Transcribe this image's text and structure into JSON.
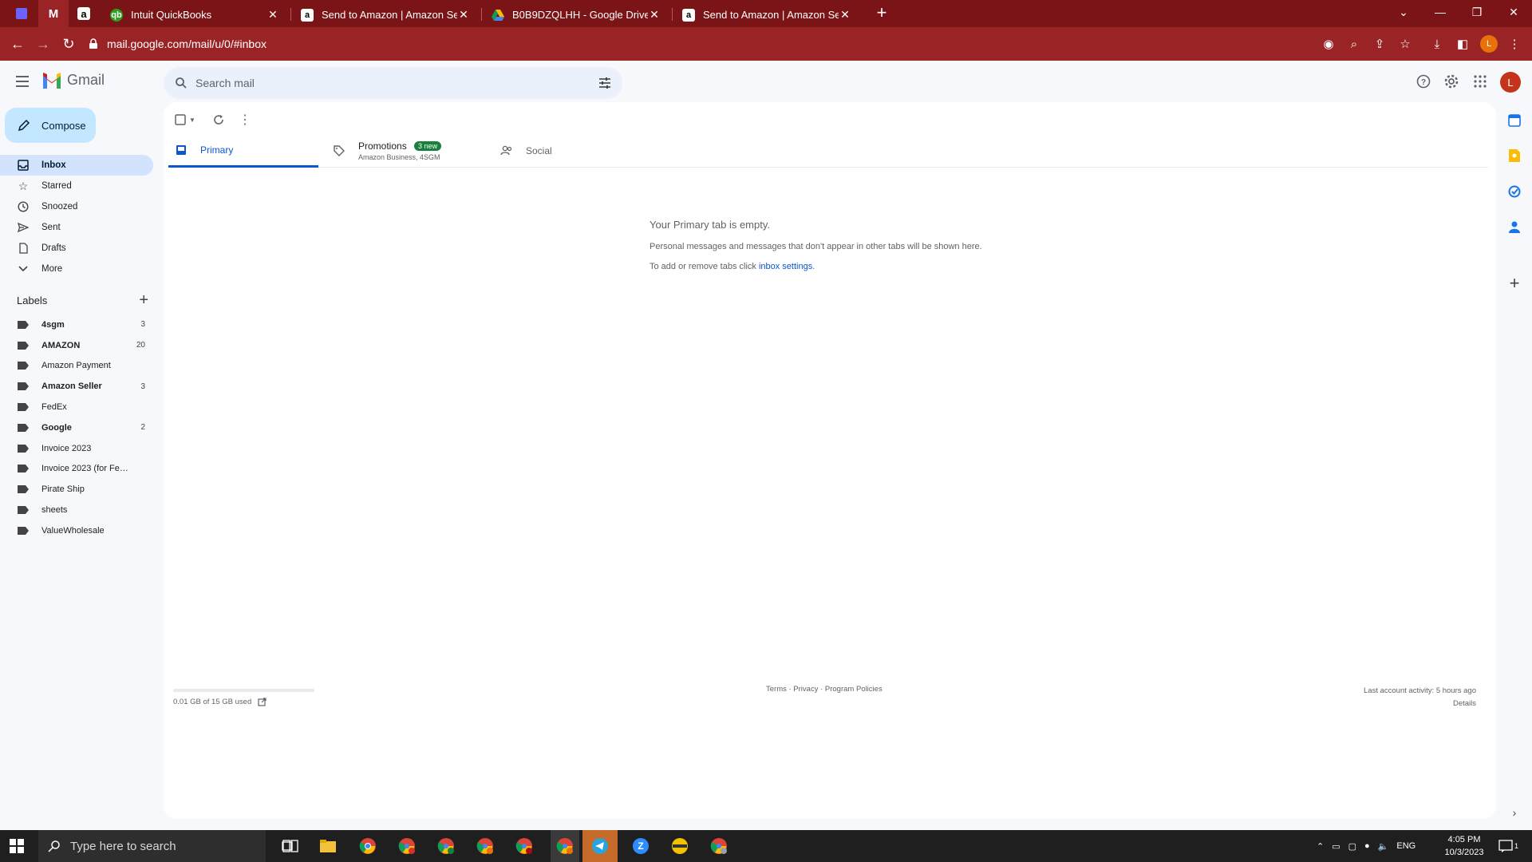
{
  "browser": {
    "tabs": [
      {
        "title": "Intuit QuickBooks",
        "favicon": "quickbooks-icon"
      },
      {
        "title": "Send to Amazon | Amazon Seller",
        "favicon": "amazon-icon"
      },
      {
        "title": "B0B9DZQLHH - Google Drive",
        "favicon": "google-drive-icon"
      },
      {
        "title": "Send to Amazon | Amazon Seller",
        "favicon": "amazon-icon"
      }
    ],
    "url": "mail.google.com/mail/u/0/#inbox",
    "profile_initial": "L",
    "chrome_color": "#9a2326"
  },
  "gmail": {
    "wordmark": "Gmail",
    "search_placeholder": "Search mail",
    "avatar_initial": "L",
    "compose_label": "Compose",
    "nav": [
      {
        "label": "Inbox",
        "icon": "inbox-icon",
        "active": true
      },
      {
        "label": "Starred",
        "icon": "star-icon"
      },
      {
        "label": "Snoozed",
        "icon": "clock-icon"
      },
      {
        "label": "Sent",
        "icon": "send-icon"
      },
      {
        "label": "Drafts",
        "icon": "draft-icon"
      },
      {
        "label": "More",
        "icon": "chevron-down-icon"
      }
    ],
    "labels_title": "Labels",
    "labels": [
      {
        "name": "4sgm",
        "count": "3",
        "bold": true
      },
      {
        "name": "AMAZON",
        "count": "20",
        "bold": true
      },
      {
        "name": "Amazon Payment",
        "count": "",
        "bold": false
      },
      {
        "name": "Amazon Seller",
        "count": "3",
        "bold": true
      },
      {
        "name": "FedEx",
        "count": "",
        "bold": false
      },
      {
        "name": "Google",
        "count": "2",
        "bold": true
      },
      {
        "name": "Invoice 2023",
        "count": "",
        "bold": false
      },
      {
        "name": "Invoice 2023 (for FedEx ...",
        "count": "",
        "bold": false
      },
      {
        "name": "Pirate Ship",
        "count": "",
        "bold": false
      },
      {
        "name": "sheets",
        "count": "",
        "bold": false
      },
      {
        "name": "ValueWholesale",
        "count": "",
        "bold": false
      }
    ],
    "tabs": {
      "primary": "Primary",
      "promotions": "Promotions",
      "promotions_badge": "3 new",
      "promotions_sub": "Amazon Business, 4SGM",
      "social": "Social"
    },
    "empty": {
      "heading": "Your Primary tab is empty.",
      "line1": "Personal messages and messages that don't appear in other tabs will be shown here.",
      "line2_prefix": "To add or remove tabs click ",
      "line2_link": "inbox settings",
      "line2_suffix": "."
    },
    "footer": {
      "storage": "0.01 GB of 15 GB used",
      "links": "Terms · Privacy · Program Policies",
      "activity": "Last account activity: 5 hours ago",
      "details": "Details"
    }
  },
  "taskbar": {
    "search_placeholder": "Type here to search",
    "language": "ENG",
    "time": "4:05 PM",
    "date": "10/3/2023",
    "notification_count": "1"
  }
}
